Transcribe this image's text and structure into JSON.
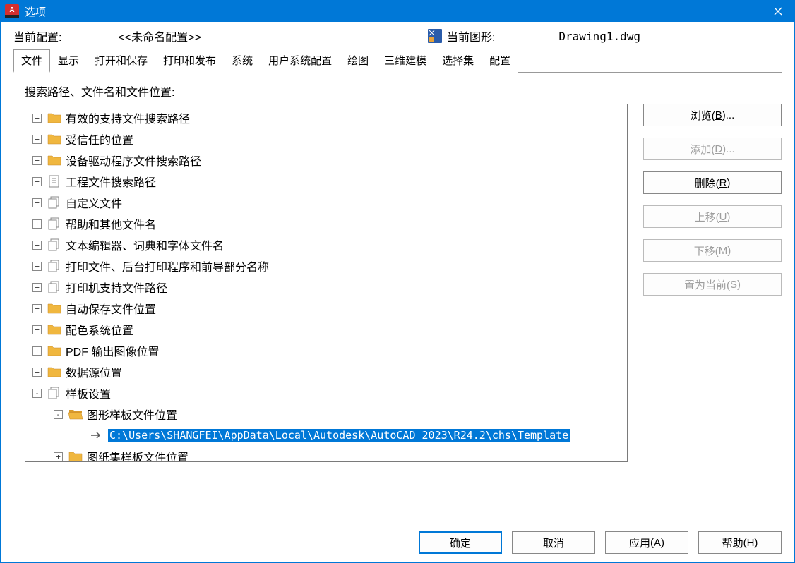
{
  "titlebar": {
    "title": "选项"
  },
  "info": {
    "profile_label": "当前配置:",
    "profile_name": "<<未命名配置>>",
    "drawing_label": "当前图形:",
    "drawing_name": "Drawing1.dwg"
  },
  "tabs": [
    "文件",
    "显示",
    "打开和保存",
    "打印和发布",
    "系统",
    "用户系统配置",
    "绘图",
    "三维建模",
    "选择集",
    "配置"
  ],
  "section_label": "搜索路径、文件名和文件位置:",
  "tree": [
    {
      "level": 1,
      "exp": "+",
      "icon": "folder",
      "label": "有效的支持文件搜索路径"
    },
    {
      "level": 1,
      "exp": "+",
      "icon": "folder",
      "label": "受信任的位置"
    },
    {
      "level": 1,
      "exp": "+",
      "icon": "folder",
      "label": "设备驱动程序文件搜索路径"
    },
    {
      "level": 1,
      "exp": "+",
      "icon": "doc",
      "label": "工程文件搜索路径"
    },
    {
      "level": 1,
      "exp": "+",
      "icon": "stack",
      "label": "自定义文件"
    },
    {
      "level": 1,
      "exp": "+",
      "icon": "stack",
      "label": "帮助和其他文件名"
    },
    {
      "level": 1,
      "exp": "+",
      "icon": "stack",
      "label": "文本编辑器、词典和字体文件名"
    },
    {
      "level": 1,
      "exp": "+",
      "icon": "stack",
      "label": "打印文件、后台打印程序和前导部分名称"
    },
    {
      "level": 1,
      "exp": "+",
      "icon": "stack",
      "label": "打印机支持文件路径"
    },
    {
      "level": 1,
      "exp": "+",
      "icon": "folder",
      "label": "自动保存文件位置"
    },
    {
      "level": 1,
      "exp": "+",
      "icon": "folder",
      "label": "配色系统位置"
    },
    {
      "level": 1,
      "exp": "+",
      "icon": "folder",
      "label": "PDF 输出图像位置"
    },
    {
      "level": 1,
      "exp": "+",
      "icon": "folder",
      "label": "数据源位置"
    },
    {
      "level": 1,
      "exp": "-",
      "icon": "stack",
      "label": "样板设置"
    },
    {
      "level": 2,
      "exp": "-",
      "icon": "folder-open",
      "label": "图形样板文件位置"
    },
    {
      "level": 3,
      "exp": "",
      "icon": "arrow",
      "label": "C:\\Users\\SHANGFEI\\AppData\\Local\\Autodesk\\AutoCAD 2023\\R24.2\\chs\\Template",
      "selected": true
    },
    {
      "level": 2,
      "exp": "+",
      "icon": "folder",
      "label": "图纸集样板文件位置"
    }
  ],
  "side_buttons": [
    {
      "label": "浏览",
      "key": "B",
      "disabled": false,
      "suffix": "..."
    },
    {
      "label": "添加",
      "key": "D",
      "disabled": true,
      "suffix": "..."
    },
    {
      "label": "删除",
      "key": "R",
      "disabled": false,
      "suffix": ""
    },
    {
      "label": "上移",
      "key": "U",
      "disabled": true,
      "suffix": ""
    },
    {
      "label": "下移",
      "key": "M",
      "disabled": true,
      "suffix": ""
    },
    {
      "label": "置为当前",
      "key": "S",
      "disabled": true,
      "suffix": ""
    }
  ],
  "bottom_buttons": {
    "ok": "确定",
    "cancel": "取消",
    "apply_label": "应用",
    "apply_key": "A",
    "help_label": "帮助",
    "help_key": "H"
  }
}
